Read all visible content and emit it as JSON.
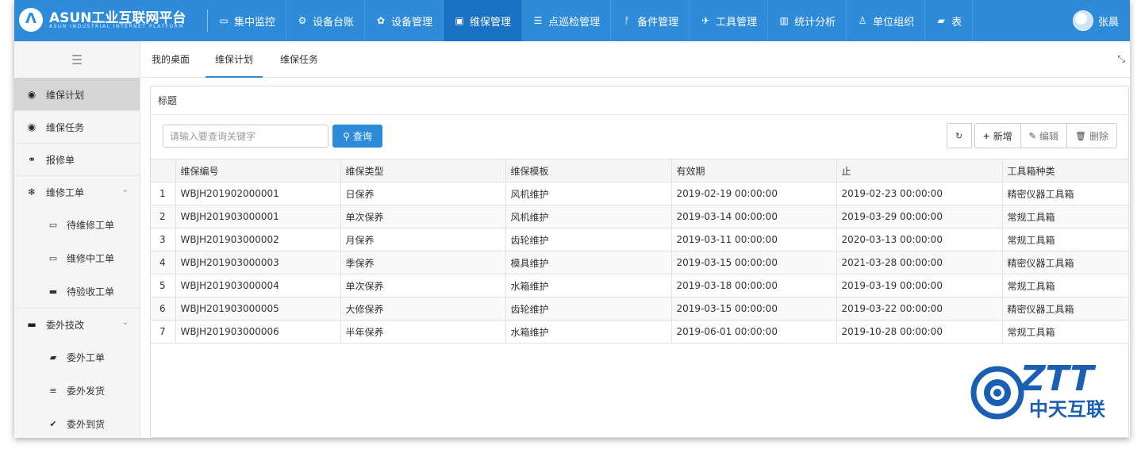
{
  "app": {
    "logo_title": "ASUN工业互联网平台",
    "logo_subtitle": "ASUN INDUSTRIAL INTERNET PLATFORM",
    "user_name": "张晨"
  },
  "nav": [
    {
      "label": "集中监控",
      "icon": "monitor-icon",
      "glyph": "▭"
    },
    {
      "label": "设备台账",
      "icon": "cubes-icon",
      "glyph": "⚙"
    },
    {
      "label": "设备管理",
      "icon": "gear-icon",
      "glyph": "✿"
    },
    {
      "label": "维保管理",
      "icon": "id-card-icon",
      "glyph": "▣"
    },
    {
      "label": "点巡检管理",
      "icon": "sliders-icon",
      "glyph": "☰"
    },
    {
      "label": "备件管理",
      "icon": "fork-icon",
      "glyph": "ᚠ"
    },
    {
      "label": "工具管理",
      "icon": "plane-icon",
      "glyph": "✈"
    },
    {
      "label": "统计分析",
      "icon": "bar-chart-icon",
      "glyph": "▥"
    },
    {
      "label": "单位组织",
      "icon": "user-icon",
      "glyph": "♙"
    },
    {
      "label": "表",
      "icon": "book-icon",
      "glyph": "▰"
    }
  ],
  "sidebar": {
    "items": [
      {
        "label": "维保计划",
        "icon": "compass-icon",
        "glyph": "◉"
      },
      {
        "label": "维保任务",
        "icon": "dot-circle-icon",
        "glyph": "◉"
      },
      {
        "label": "报修单",
        "icon": "handshake-icon",
        "glyph": "⚭"
      },
      {
        "label": "维修工单",
        "icon": "snowflake-icon",
        "glyph": "❄",
        "caret": "⌄"
      },
      {
        "label": "待维修工单",
        "icon": "battery-empty-icon",
        "glyph": "▭"
      },
      {
        "label": "维修中工单",
        "icon": "battery-quarter-icon",
        "glyph": "▭"
      },
      {
        "label": "待验收工单",
        "icon": "battery-half-icon",
        "glyph": "▬"
      },
      {
        "label": "委外技改",
        "icon": "credit-card-icon",
        "glyph": "▬",
        "caret": "⌄"
      },
      {
        "label": "委外工单",
        "icon": "book-icon",
        "glyph": "▰"
      },
      {
        "label": "委外发货",
        "icon": "list-icon",
        "glyph": "≡"
      },
      {
        "label": "委外到货",
        "icon": "check-icon",
        "glyph": "✔"
      }
    ]
  },
  "tabs": [
    "我的桌面",
    "维保计划",
    "维保任务"
  ],
  "panel": {
    "title": "标题",
    "search_placeholder": "请输入要查询关键字",
    "query_label": "查询",
    "add_label": "新增",
    "edit_label": "编辑",
    "delete_label": "删除"
  },
  "table": {
    "columns": [
      "维保编号",
      "维保类型",
      "维保模板",
      "有效期",
      "止",
      "工具箱种类"
    ],
    "rows": [
      [
        "1",
        "WBJH201902000001",
        "日保养",
        "风机维护",
        "2019-02-19 00:00:00",
        "2019-02-23 00:00:00",
        "精密仪器工具箱"
      ],
      [
        "2",
        "WBJH201903000001",
        "单次保养",
        "风机维护",
        "2019-03-14 00:00:00",
        "2019-03-29 00:00:00",
        "常规工具箱"
      ],
      [
        "3",
        "WBJH201903000002",
        "月保养",
        "齿轮维护",
        "2019-03-11 00:00:00",
        "2020-03-13 00:00:00",
        "常规工具箱"
      ],
      [
        "4",
        "WBJH201903000003",
        "季保养",
        "模具维护",
        "2019-03-15 00:00:00",
        "2021-03-28 00:00:00",
        "精密仪器工具箱"
      ],
      [
        "5",
        "WBJH201903000004",
        "单次保养",
        "水箱维护",
        "2019-03-18 00:00:00",
        "2019-03-19 00:00:00",
        "常规工具箱"
      ],
      [
        "6",
        "WBJH201903000005",
        "大修保养",
        "齿轮维护",
        "2019-03-15 00:00:00",
        "2019-03-22 00:00:00",
        "精密仪器工具箱"
      ],
      [
        "7",
        "WBJH201903000006",
        "半年保养",
        "水箱维护",
        "2019-06-01 00:00:00",
        "2019-10-28 00:00:00",
        "常规工具箱"
      ]
    ]
  },
  "watermark": {
    "brand": "ZTT",
    "brand_cn": "中天互联"
  },
  "colors": {
    "primary": "#2e8bd9",
    "nav_active": "#1a71c4",
    "watermark": "#1a5fb4"
  }
}
